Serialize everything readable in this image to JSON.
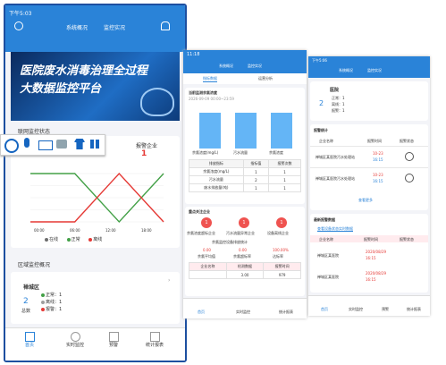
{
  "status_time": "下午5:03",
  "phone1": {
    "tabs": [
      "系统概况",
      "监控实况"
    ],
    "banner_title_1": "医院废水消毒治理全过程",
    "banner_title_2": "大数据监控平台",
    "section1_title": "联网监控状态",
    "alarm_label": "报警企业",
    "alarm_count": "1",
    "legend": [
      "在线",
      "正常",
      "离线"
    ],
    "x_ticks": [
      "00:00",
      "06:00",
      "12:00",
      "18:00"
    ],
    "chart_data": {
      "type": "line",
      "x": [
        "00:00",
        "06:00",
        "12:00",
        "18:00"
      ],
      "series": [
        {
          "values": [
            1,
            1,
            0,
            1
          ]
        },
        {
          "values": [
            0,
            0,
            1,
            0
          ]
        }
      ],
      "title": "",
      "xlabel": "",
      "ylabel": ""
    },
    "section2_title": "区域监控概况",
    "region_name": "禅城区",
    "region_count": "2",
    "region_unit": "总数",
    "region_stats": [
      {
        "label": "正常：",
        "value": "1"
      },
      {
        "label": "离线：",
        "value": "1"
      },
      {
        "label": "报警：",
        "value": "1"
      }
    ],
    "nav": [
      "首页",
      "实时监控",
      "预警",
      "统计报表"
    ]
  },
  "toolbar_icons": [
    "smile-icon",
    "microphone-icon",
    "keyboard-icon",
    "robot-icon",
    "shirt-icon",
    "grid-icon"
  ],
  "phone2": {
    "time": "11:18",
    "tabs": [
      "系统概况",
      "监控实况"
    ],
    "subtabs": [
      "指标数据",
      "运营分析"
    ],
    "section_title": "当前监测余氯浓度",
    "sub_date": "2026-09-09 00:00~23:59",
    "bars_labels": [
      "余氯浓度(mg/L)",
      "污水流量",
      "余氯浓度"
    ],
    "table_headers": [
      "排放指标",
      "指标值",
      "报警次数"
    ],
    "table_rows": [
      [
        "余氯浓度(mg/L)",
        "1",
        "1"
      ],
      [
        "污水流量",
        "2",
        "1"
      ],
      [
        "废水排放量(吨)",
        "1",
        "1"
      ]
    ],
    "section2_title": "重点关注企业",
    "circle_labels": [
      "1",
      "1",
      "1"
    ],
    "circle_captions": [
      "余氯浓度超标企业",
      "污水流量异常企业",
      "设备离线企业"
    ],
    "mini_title": "余氯监控设备排放统计",
    "mini_values": [
      "0.00",
      "0.00",
      "100.00%"
    ],
    "mini_labels": [
      "余氯平均值",
      "余氯超标率",
      "达标率"
    ],
    "table2_headers": [
      "企业名称",
      "检测数据",
      "报警时间"
    ],
    "table2_values": [
      "3.00",
      "979"
    ],
    "nav": [
      "首页",
      "实时监控",
      "统计报表"
    ]
  },
  "phone3": {
    "time": "下午5:06",
    "tabs": [
      "系统概况",
      "监控实况"
    ],
    "hospital_title": "医院",
    "hospital_count": "2",
    "hospital_stats": [
      "正常：1",
      "离线：1",
      "报警：1"
    ],
    "section_title": "报警统计",
    "table_headers": [
      "企业名称",
      "报警时间",
      "报警状态"
    ],
    "rows": [
      {
        "name": "禅城区某医院污水处理站",
        "date": "10-23",
        "time": "16:15"
      },
      {
        "name": "禅城区某医院污水处理站",
        "date": "10-23",
        "time": "16:15"
      }
    ],
    "more": "查看更多",
    "section2_title": "最新报警数据",
    "link": "查看设备状态实时数据",
    "table2_headers": [
      "企业名称",
      "报警时间",
      "报警状态"
    ],
    "rows2": [
      {
        "name": "禅城区某医院",
        "date": "2020/08/29",
        "time": "16:15"
      },
      {
        "name": "禅城区某医院",
        "date": "2020/08/29",
        "time": "16:15"
      }
    ],
    "nav": [
      "首页",
      "实时监控",
      "预警",
      "统计报表"
    ]
  }
}
